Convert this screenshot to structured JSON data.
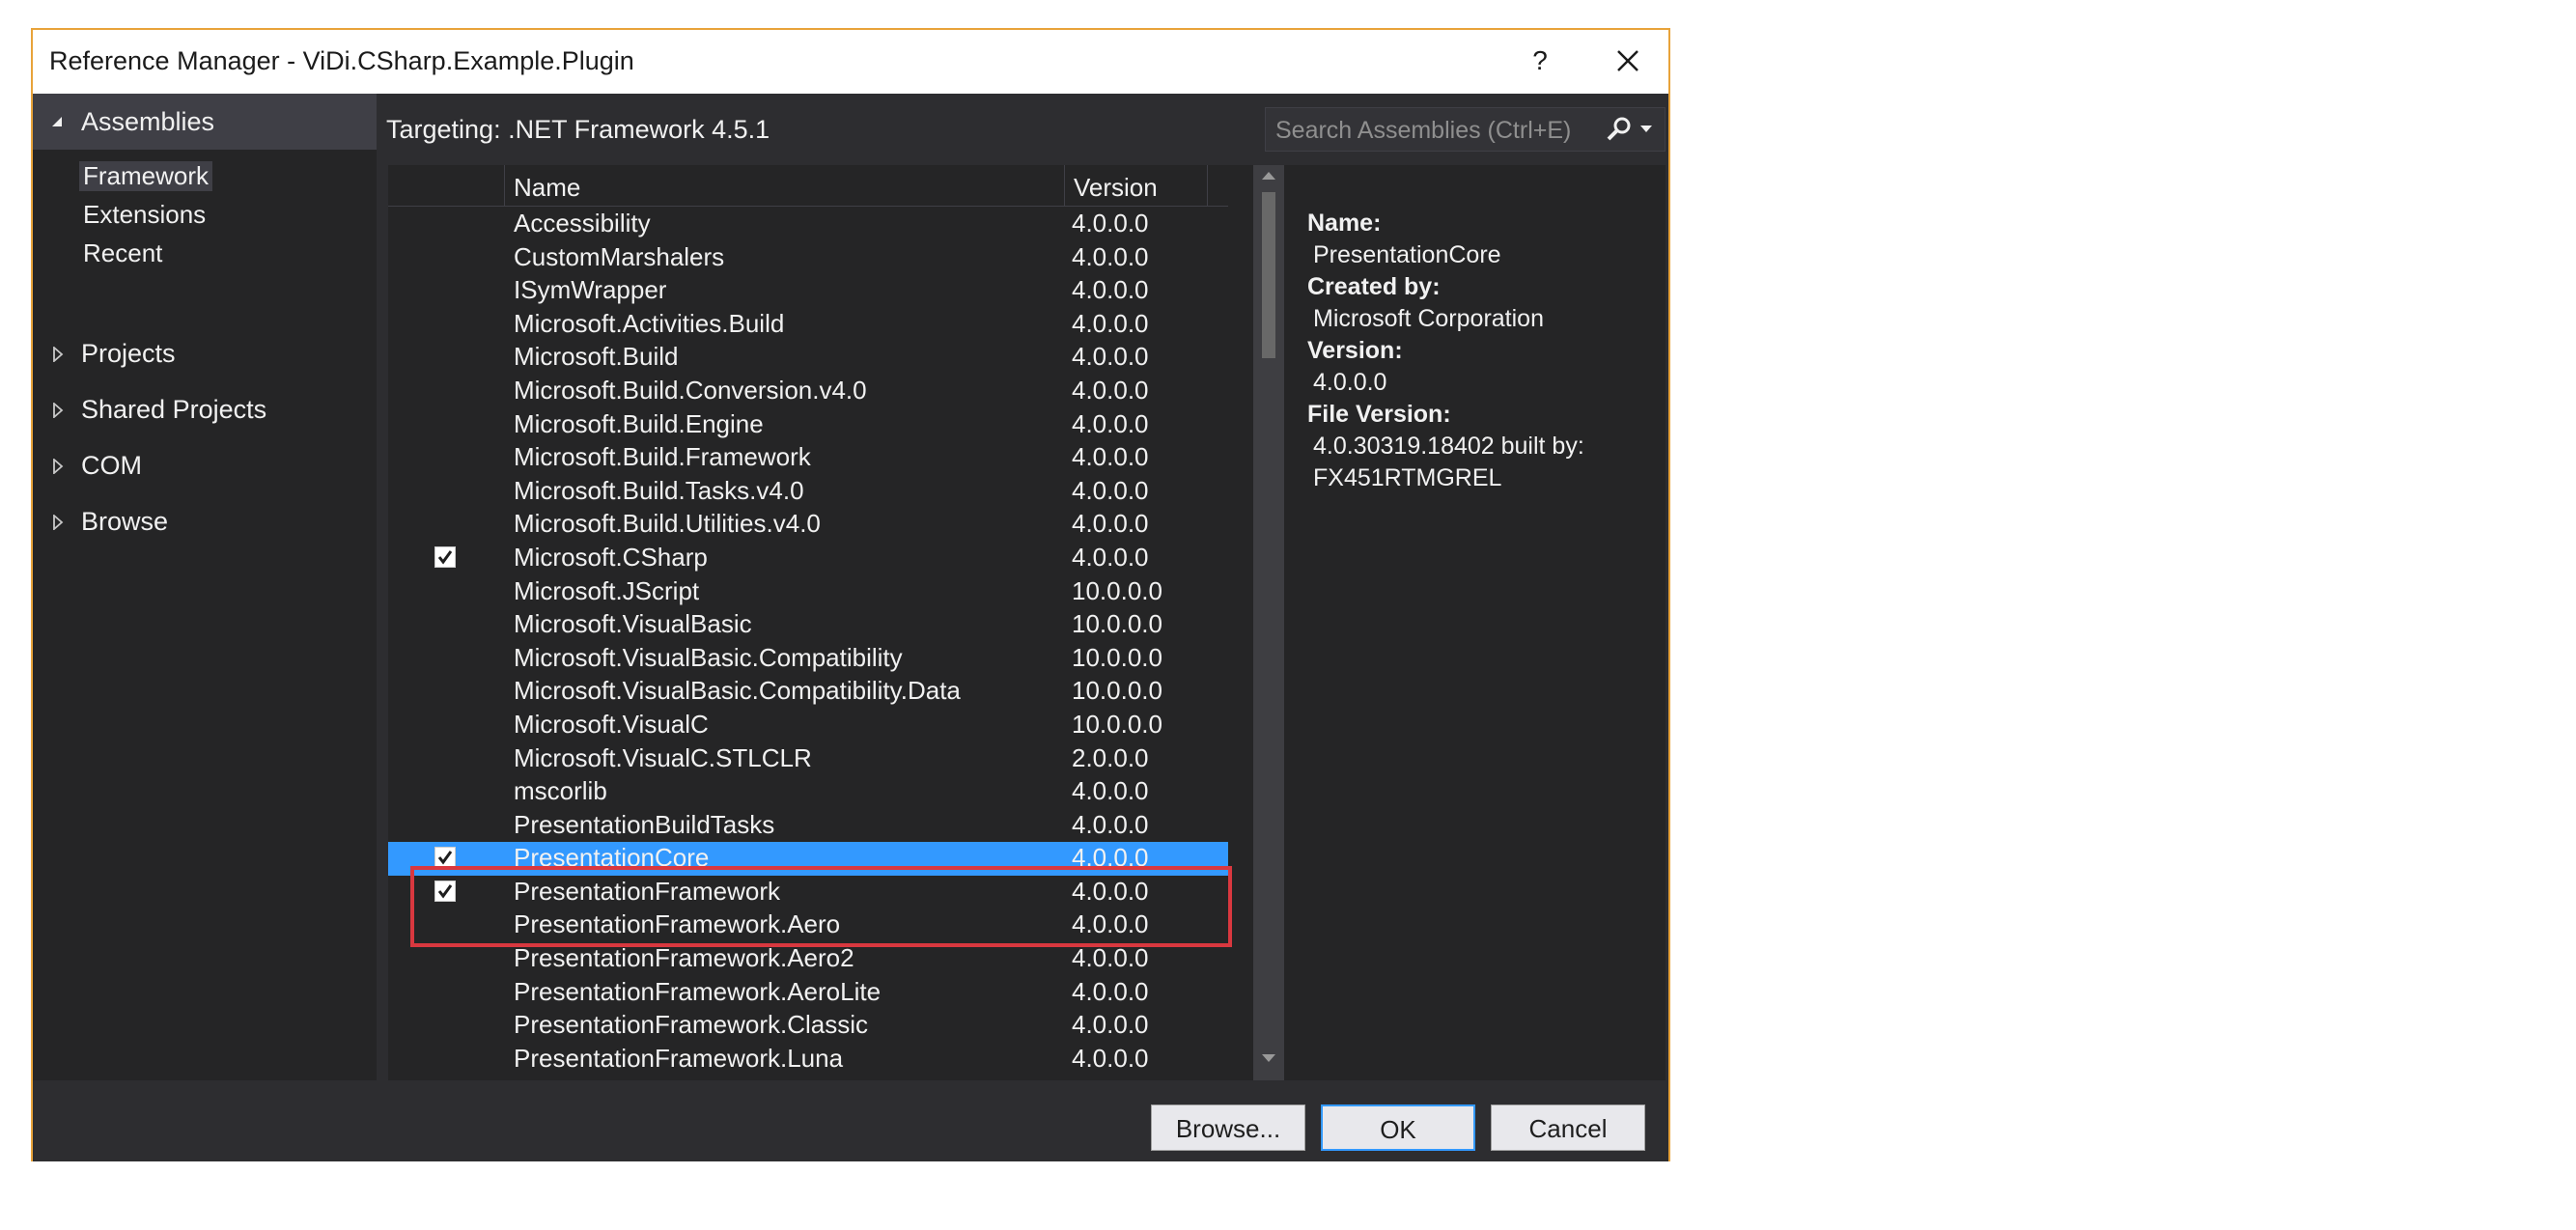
{
  "window": {
    "title": "Reference Manager - ViDi.CSharp.Example.Plugin",
    "help_label": "?",
    "accent_color": "#e8a33a"
  },
  "sidebar": {
    "assemblies_label": "Assemblies",
    "sub_items": [
      "Framework",
      "Extensions",
      "Recent"
    ],
    "selected_sub_item": "Framework",
    "nodes": [
      "Projects",
      "Shared Projects",
      "COM",
      "Browse"
    ]
  },
  "main": {
    "targeting": "Targeting: .NET Framework 4.5.1",
    "search": {
      "placeholder": "Search Assemblies (Ctrl+E)"
    },
    "columns": {
      "name": "Name",
      "version": "Version"
    },
    "rows": [
      {
        "name": "Accessibility",
        "version": "4.0.0.0",
        "checked": false
      },
      {
        "name": "CustomMarshalers",
        "version": "4.0.0.0",
        "checked": false
      },
      {
        "name": "ISymWrapper",
        "version": "4.0.0.0",
        "checked": false
      },
      {
        "name": "Microsoft.Activities.Build",
        "version": "4.0.0.0",
        "checked": false
      },
      {
        "name": "Microsoft.Build",
        "version": "4.0.0.0",
        "checked": false
      },
      {
        "name": "Microsoft.Build.Conversion.v4.0",
        "version": "4.0.0.0",
        "checked": false
      },
      {
        "name": "Microsoft.Build.Engine",
        "version": "4.0.0.0",
        "checked": false
      },
      {
        "name": "Microsoft.Build.Framework",
        "version": "4.0.0.0",
        "checked": false
      },
      {
        "name": "Microsoft.Build.Tasks.v4.0",
        "version": "4.0.0.0",
        "checked": false
      },
      {
        "name": "Microsoft.Build.Utilities.v4.0",
        "version": "4.0.0.0",
        "checked": false
      },
      {
        "name": "Microsoft.CSharp",
        "version": "4.0.0.0",
        "checked": true
      },
      {
        "name": "Microsoft.JScript",
        "version": "10.0.0.0",
        "checked": false
      },
      {
        "name": "Microsoft.VisualBasic",
        "version": "10.0.0.0",
        "checked": false
      },
      {
        "name": "Microsoft.VisualBasic.Compatibility",
        "version": "10.0.0.0",
        "checked": false
      },
      {
        "name": "Microsoft.VisualBasic.Compatibility.Data",
        "version": "10.0.0.0",
        "checked": false
      },
      {
        "name": "Microsoft.VisualC",
        "version": "10.0.0.0",
        "checked": false
      },
      {
        "name": "Microsoft.VisualC.STLCLR",
        "version": "2.0.0.0",
        "checked": false
      },
      {
        "name": "mscorlib",
        "version": "4.0.0.0",
        "checked": false
      },
      {
        "name": "PresentationBuildTasks",
        "version": "4.0.0.0",
        "checked": false
      },
      {
        "name": "PresentationCore",
        "version": "4.0.0.0",
        "checked": true,
        "selected": true
      },
      {
        "name": "PresentationFramework",
        "version": "4.0.0.0",
        "checked": true
      },
      {
        "name": "PresentationFramework.Aero",
        "version": "4.0.0.0",
        "checked": false
      },
      {
        "name": "PresentationFramework.Aero2",
        "version": "4.0.0.0",
        "checked": false
      },
      {
        "name": "PresentationFramework.AeroLite",
        "version": "4.0.0.0",
        "checked": false
      },
      {
        "name": "PresentationFramework.Classic",
        "version": "4.0.0.0",
        "checked": false
      },
      {
        "name": "PresentationFramework.Luna",
        "version": "4.0.0.0",
        "checked": false
      }
    ]
  },
  "details": {
    "name_label": "Name:",
    "name_value": "PresentationCore",
    "created_by_label": "Created by:",
    "created_by_value": "Microsoft Corporation",
    "version_label": "Version:",
    "version_value": "4.0.0.0",
    "file_version_label": "File Version:",
    "file_version_line1": "4.0.30319.18402 built by:",
    "file_version_line2": "FX451RTMGREL"
  },
  "buttons": {
    "browse": "Browse...",
    "ok": "OK",
    "cancel": "Cancel"
  },
  "colors": {
    "selection": "#3399ff",
    "highlight_box": "#d9383f"
  }
}
